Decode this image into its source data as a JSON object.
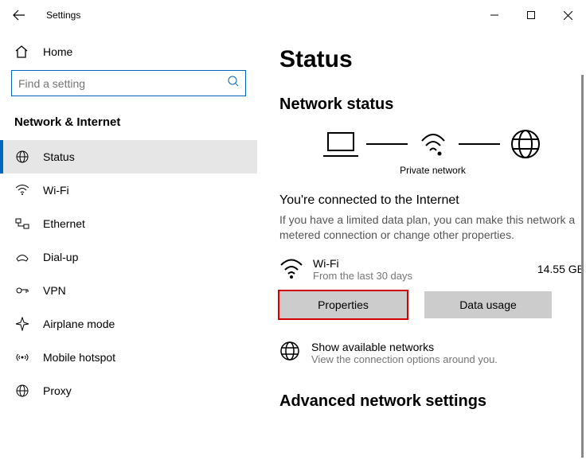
{
  "titlebar": {
    "title": "Settings"
  },
  "sidebar": {
    "home": "Home",
    "search_placeholder": "Find a setting",
    "section": "Network & Internet",
    "items": [
      {
        "label": "Status"
      },
      {
        "label": "Wi-Fi"
      },
      {
        "label": "Ethernet"
      },
      {
        "label": "Dial-up"
      },
      {
        "label": "VPN"
      },
      {
        "label": "Airplane mode"
      },
      {
        "label": "Mobile hotspot"
      },
      {
        "label": "Proxy"
      }
    ]
  },
  "content": {
    "heading": "Status",
    "subheading": "Network status",
    "private": "Private network",
    "connected": "You're connected to the Internet",
    "description": "If you have a limited data plan, you can make this network a metered connection or change other properties.",
    "wifi": {
      "name": "Wi-Fi",
      "sub": "From the last 30 days",
      "usage": "14.55 GB"
    },
    "buttons": {
      "properties": "Properties",
      "data_usage": "Data usage"
    },
    "available": {
      "title": "Show available networks",
      "sub": "View the connection options around you."
    },
    "advanced": "Advanced network settings"
  }
}
